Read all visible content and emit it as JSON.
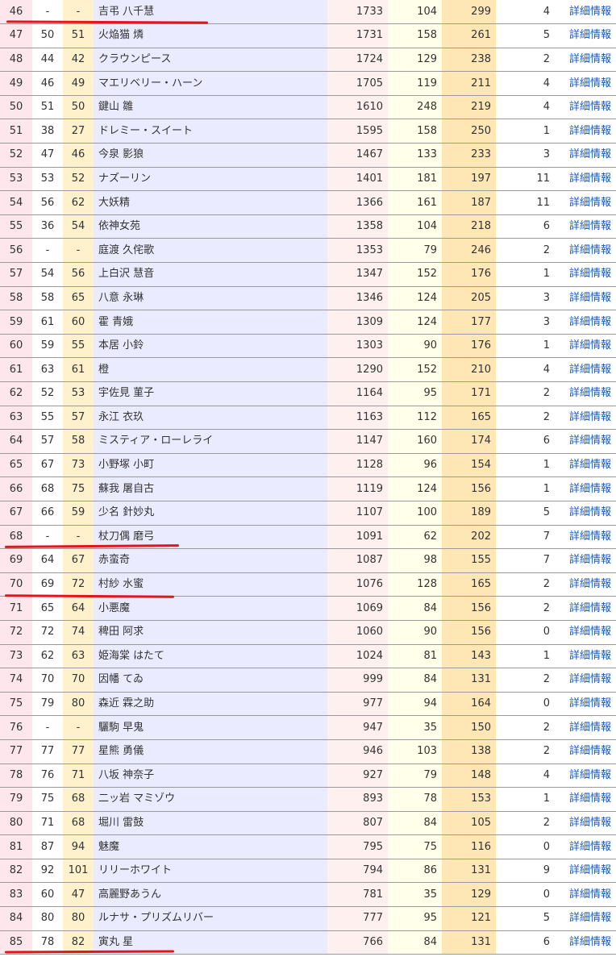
{
  "ranking": {
    "detail_label": "詳細情報",
    "rows": [
      {
        "rank": "46",
        "prev1": "-",
        "prev2": "-",
        "name": "吉弔 八千慧",
        "v1": "1733",
        "v2": "104",
        "v3": "299",
        "v4": "4"
      },
      {
        "rank": "47",
        "prev1": "50",
        "prev2": "51",
        "name": "火焔猫 燐",
        "v1": "1731",
        "v2": "158",
        "v3": "261",
        "v4": "5"
      },
      {
        "rank": "48",
        "prev1": "44",
        "prev2": "42",
        "name": "クラウンピース",
        "v1": "1724",
        "v2": "129",
        "v3": "238",
        "v4": "2"
      },
      {
        "rank": "49",
        "prev1": "46",
        "prev2": "49",
        "name": "マエリベリー・ハーン",
        "v1": "1705",
        "v2": "119",
        "v3": "211",
        "v4": "4"
      },
      {
        "rank": "50",
        "prev1": "51",
        "prev2": "50",
        "name": "鍵山 雛",
        "v1": "1610",
        "v2": "248",
        "v3": "219",
        "v4": "4"
      },
      {
        "rank": "51",
        "prev1": "38",
        "prev2": "27",
        "name": "ドレミー・スイート",
        "v1": "1595",
        "v2": "158",
        "v3": "250",
        "v4": "1"
      },
      {
        "rank": "52",
        "prev1": "47",
        "prev2": "46",
        "name": "今泉 影狼",
        "v1": "1467",
        "v2": "133",
        "v3": "233",
        "v4": "3"
      },
      {
        "rank": "53",
        "prev1": "53",
        "prev2": "52",
        "name": "ナズーリン",
        "v1": "1401",
        "v2": "181",
        "v3": "197",
        "v4": "11"
      },
      {
        "rank": "54",
        "prev1": "56",
        "prev2": "62",
        "name": "大妖精",
        "v1": "1366",
        "v2": "161",
        "v3": "187",
        "v4": "11"
      },
      {
        "rank": "55",
        "prev1": "36",
        "prev2": "54",
        "name": "依神女苑",
        "v1": "1358",
        "v2": "104",
        "v3": "218",
        "v4": "6"
      },
      {
        "rank": "56",
        "prev1": "-",
        "prev2": "-",
        "name": "庭渡 久侘歌",
        "v1": "1353",
        "v2": "79",
        "v3": "246",
        "v4": "2"
      },
      {
        "rank": "57",
        "prev1": "54",
        "prev2": "56",
        "name": "上白沢 慧音",
        "v1": "1347",
        "v2": "152",
        "v3": "176",
        "v4": "1"
      },
      {
        "rank": "58",
        "prev1": "58",
        "prev2": "65",
        "name": "八意 永琳",
        "v1": "1346",
        "v2": "124",
        "v3": "205",
        "v4": "3"
      },
      {
        "rank": "59",
        "prev1": "61",
        "prev2": "60",
        "name": "霍 青娥",
        "v1": "1309",
        "v2": "124",
        "v3": "177",
        "v4": "3"
      },
      {
        "rank": "60",
        "prev1": "59",
        "prev2": "55",
        "name": "本居 小鈴",
        "v1": "1303",
        "v2": "90",
        "v3": "176",
        "v4": "1"
      },
      {
        "rank": "61",
        "prev1": "63",
        "prev2": "61",
        "name": "橙",
        "v1": "1290",
        "v2": "152",
        "v3": "210",
        "v4": "4"
      },
      {
        "rank": "62",
        "prev1": "52",
        "prev2": "53",
        "name": "宇佐見 菫子",
        "v1": "1164",
        "v2": "95",
        "v3": "171",
        "v4": "2"
      },
      {
        "rank": "63",
        "prev1": "55",
        "prev2": "57",
        "name": "永江 衣玖",
        "v1": "1163",
        "v2": "112",
        "v3": "165",
        "v4": "2"
      },
      {
        "rank": "64",
        "prev1": "57",
        "prev2": "58",
        "name": "ミスティア・ローレライ",
        "v1": "1147",
        "v2": "160",
        "v3": "174",
        "v4": "6"
      },
      {
        "rank": "65",
        "prev1": "67",
        "prev2": "73",
        "name": "小野塚 小町",
        "v1": "1128",
        "v2": "96",
        "v3": "154",
        "v4": "1"
      },
      {
        "rank": "66",
        "prev1": "68",
        "prev2": "75",
        "name": "蘇我 屠自古",
        "v1": "1119",
        "v2": "124",
        "v3": "156",
        "v4": "1"
      },
      {
        "rank": "67",
        "prev1": "66",
        "prev2": "59",
        "name": "少名 針妙丸",
        "v1": "1107",
        "v2": "100",
        "v3": "189",
        "v4": "5"
      },
      {
        "rank": "68",
        "prev1": "-",
        "prev2": "-",
        "name": "杖刀偶 磨弓",
        "v1": "1091",
        "v2": "62",
        "v3": "202",
        "v4": "7"
      },
      {
        "rank": "69",
        "prev1": "64",
        "prev2": "67",
        "name": "赤蛮奇",
        "v1": "1087",
        "v2": "98",
        "v3": "155",
        "v4": "7"
      },
      {
        "rank": "70",
        "prev1": "69",
        "prev2": "72",
        "name": "村紗 水蜜",
        "v1": "1076",
        "v2": "128",
        "v3": "165",
        "v4": "2"
      },
      {
        "rank": "71",
        "prev1": "65",
        "prev2": "64",
        "name": "小悪魔",
        "v1": "1069",
        "v2": "84",
        "v3": "156",
        "v4": "2"
      },
      {
        "rank": "72",
        "prev1": "72",
        "prev2": "74",
        "name": "稗田 阿求",
        "v1": "1060",
        "v2": "90",
        "v3": "156",
        "v4": "0"
      },
      {
        "rank": "73",
        "prev1": "62",
        "prev2": "63",
        "name": "姫海棠 はたて",
        "v1": "1024",
        "v2": "81",
        "v3": "143",
        "v4": "1"
      },
      {
        "rank": "74",
        "prev1": "70",
        "prev2": "70",
        "name": "因幡 てゐ",
        "v1": "999",
        "v2": "84",
        "v3": "131",
        "v4": "2"
      },
      {
        "rank": "75",
        "prev1": "79",
        "prev2": "80",
        "name": "森近 霖之助",
        "v1": "977",
        "v2": "94",
        "v3": "164",
        "v4": "0"
      },
      {
        "rank": "76",
        "prev1": "-",
        "prev2": "-",
        "name": "驪駒 早鬼",
        "v1": "947",
        "v2": "35",
        "v3": "150",
        "v4": "2"
      },
      {
        "rank": "77",
        "prev1": "77",
        "prev2": "77",
        "name": "星熊 勇儀",
        "v1": "946",
        "v2": "103",
        "v3": "138",
        "v4": "2"
      },
      {
        "rank": "78",
        "prev1": "76",
        "prev2": "71",
        "name": "八坂 神奈子",
        "v1": "927",
        "v2": "79",
        "v3": "148",
        "v4": "4"
      },
      {
        "rank": "79",
        "prev1": "75",
        "prev2": "68",
        "name": "二ッ岩 マミゾウ",
        "v1": "893",
        "v2": "78",
        "v3": "153",
        "v4": "1"
      },
      {
        "rank": "80",
        "prev1": "71",
        "prev2": "68",
        "name": "堀川 雷鼓",
        "v1": "807",
        "v2": "84",
        "v3": "105",
        "v4": "2"
      },
      {
        "rank": "81",
        "prev1": "87",
        "prev2": "94",
        "name": "魅魔",
        "v1": "795",
        "v2": "75",
        "v3": "116",
        "v4": "0"
      },
      {
        "rank": "82",
        "prev1": "92",
        "prev2": "101",
        "name": "リリーホワイト",
        "v1": "794",
        "v2": "86",
        "v3": "131",
        "v4": "9"
      },
      {
        "rank": "83",
        "prev1": "60",
        "prev2": "47",
        "name": "高麗野あうん",
        "v1": "781",
        "v2": "35",
        "v3": "129",
        "v4": "0"
      },
      {
        "rank": "84",
        "prev1": "80",
        "prev2": "80",
        "name": "ルナサ・プリズムリバー",
        "v1": "777",
        "v2": "95",
        "v3": "121",
        "v4": "5"
      },
      {
        "rank": "85",
        "prev1": "78",
        "prev2": "82",
        "name": "寅丸 星",
        "v1": "766",
        "v2": "84",
        "v3": "131",
        "v4": "6"
      }
    ]
  },
  "annotations": {
    "color": "#e3141c"
  }
}
